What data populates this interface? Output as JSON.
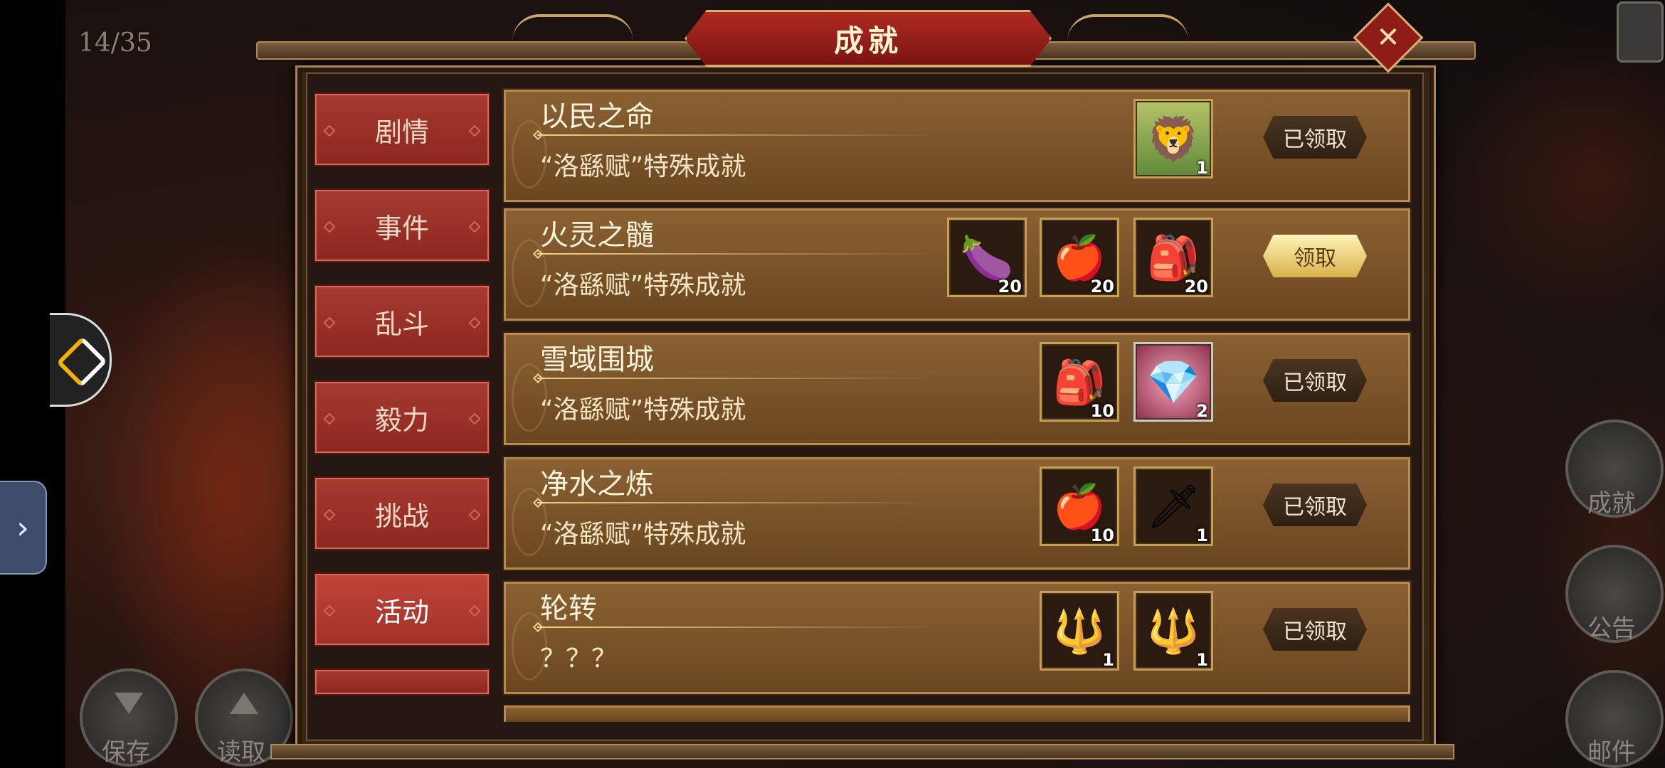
{
  "hud": {
    "page_counter": "14/35"
  },
  "dialog": {
    "title": "成就",
    "close_label": "✕"
  },
  "categories": [
    {
      "label": "剧情",
      "active": false
    },
    {
      "label": "事件",
      "active": false
    },
    {
      "label": "乱斗",
      "active": false
    },
    {
      "label": "毅力",
      "active": false
    },
    {
      "label": "挑战",
      "active": false
    },
    {
      "label": "活动",
      "active": true
    }
  ],
  "achievements": [
    {
      "title": "以民之命",
      "desc": "“洛繇赋”特殊成就",
      "rewards": [
        {
          "icon": "chibi-general-portrait-icon",
          "glyph": "🦁",
          "count": "1",
          "style": "gold"
        }
      ],
      "button": "已领取",
      "claimable": false
    },
    {
      "title": "火灵之髓",
      "desc": "“洛繇赋”特殊成就",
      "rewards": [
        {
          "icon": "blue-gourd-fruit-icon",
          "glyph": "🍆",
          "count": "20",
          "style": ""
        },
        {
          "icon": "red-pomegranate-icon",
          "glyph": "🍎",
          "count": "20",
          "style": ""
        },
        {
          "icon": "red-pouch-icon",
          "glyph": "🎒",
          "count": "20",
          "style": ""
        }
      ],
      "button": "领取",
      "claimable": true
    },
    {
      "title": "雪域围城",
      "desc": "“洛繇赋”特殊成就",
      "rewards": [
        {
          "icon": "red-pouch-icon",
          "glyph": "🎒",
          "count": "10",
          "style": ""
        },
        {
          "icon": "pink-crystal-icon",
          "glyph": "💎",
          "count": "2",
          "style": "pink"
        }
      ],
      "button": "已领取",
      "claimable": false
    },
    {
      "title": "净水之炼",
      "desc": "“洛繇赋”特殊成就",
      "rewards": [
        {
          "icon": "red-pomegranate-icon",
          "glyph": "🍎",
          "count": "10",
          "style": ""
        },
        {
          "icon": "sword-icon",
          "glyph": "🗡",
          "count": "1",
          "style": ""
        }
      ],
      "button": "已领取",
      "claimable": false
    },
    {
      "title": "轮转",
      "desc": "？？？",
      "rewards": [
        {
          "icon": "red-tassel-spear-icon",
          "glyph": "🔱",
          "count": "1",
          "style": ""
        },
        {
          "icon": "gold-spear-icon",
          "glyph": "🔱",
          "count": "1",
          "style": ""
        }
      ],
      "button": "已领取",
      "claimable": false
    }
  ],
  "side_menu": [
    {
      "label": "成就",
      "icon": "achievement-icon"
    },
    {
      "label": "公告",
      "icon": "scroll-icon"
    },
    {
      "label": "邮件",
      "icon": "mail-icon"
    }
  ],
  "bottom_menu": [
    {
      "label": "保存",
      "icon": "save-icon"
    },
    {
      "label": "读取",
      "icon": "load-icon"
    }
  ],
  "colors": {
    "title_red": "#a52820",
    "gold_trim": "#d8b070",
    "row_brown": "#7a5228",
    "claim_gold": "#e6c860"
  }
}
